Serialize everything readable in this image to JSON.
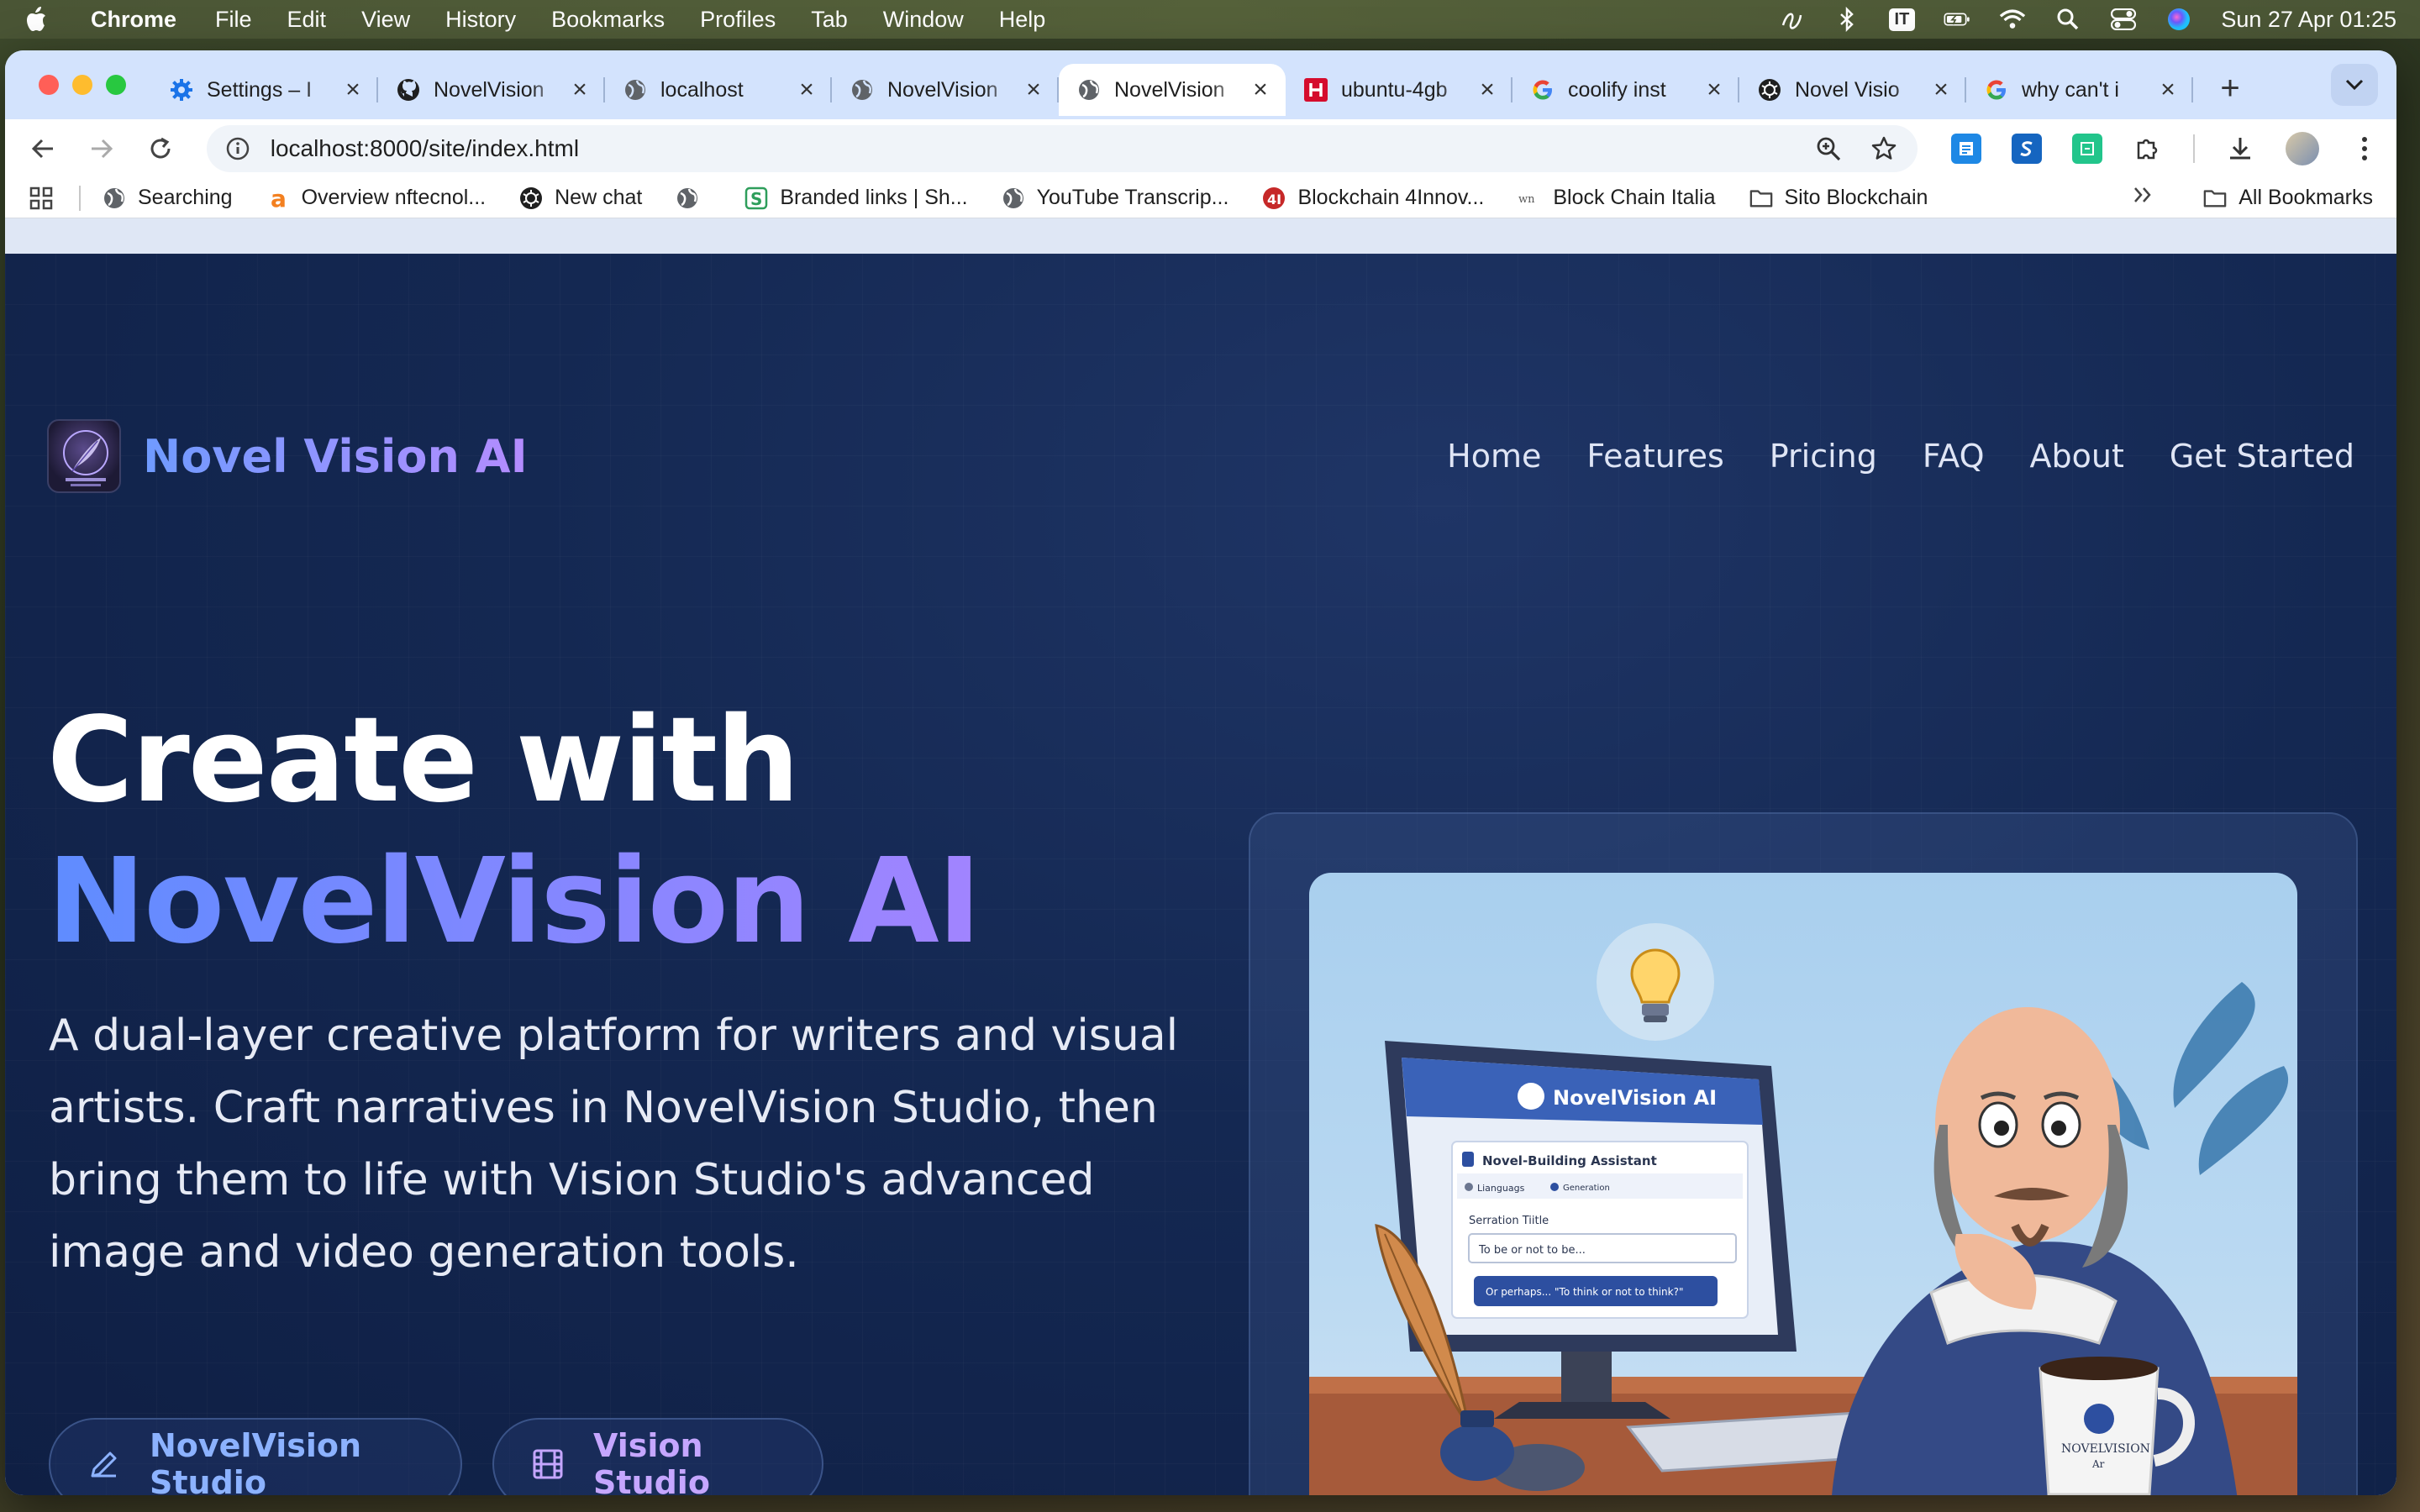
{
  "menubar": {
    "app_name": "Chrome",
    "menus": [
      "File",
      "Edit",
      "View",
      "History",
      "Bookmarks",
      "Profiles",
      "Tab",
      "Window",
      "Help"
    ],
    "input_source": "IT",
    "datetime": "Sun 27 Apr  01:25"
  },
  "tabs": [
    {
      "title": "Settings – I",
      "icon": "gear-icon",
      "active": false
    },
    {
      "title": "NovelVision",
      "icon": "github-icon",
      "active": false
    },
    {
      "title": "localhost",
      "icon": "globe-icon",
      "active": false
    },
    {
      "title": "NovelVision",
      "icon": "globe-icon",
      "active": false
    },
    {
      "title": "NovelVision",
      "icon": "globe-icon",
      "active": true
    },
    {
      "title": "ubuntu-4gb",
      "icon": "hetzner-icon",
      "active": false
    },
    {
      "title": "coolify inst",
      "icon": "google-icon",
      "active": false
    },
    {
      "title": "Novel Visio",
      "icon": "openai-icon",
      "active": false
    },
    {
      "title": "why can't i",
      "icon": "google-icon",
      "active": false
    }
  ],
  "toolbar": {
    "url": "localhost:8000/site/index.html"
  },
  "bookmarks": {
    "items": [
      {
        "label": "Searching",
        "icon": "globe-icon"
      },
      {
        "label": "Overview nftecnol...",
        "icon": "a-icon"
      },
      {
        "label": "New chat",
        "icon": "openai-icon"
      },
      {
        "label": "",
        "icon": "globe-icon"
      },
      {
        "label": "Branded links | Sh...",
        "icon": "s-icon"
      },
      {
        "label": "YouTube Transcrip...",
        "icon": "globe-icon"
      },
      {
        "label": "Blockchain 4Innov...",
        "icon": "b-icon"
      },
      {
        "label": "Block Chain Italia",
        "icon": "wn-icon"
      },
      {
        "label": "Sito Blockchain",
        "icon": "folder-icon"
      }
    ],
    "all_bookmarks": "All Bookmarks"
  },
  "site": {
    "brand": "Novel Vision AI",
    "nav": [
      "Home",
      "Features",
      "Pricing",
      "FAQ",
      "About",
      "Get Started"
    ],
    "hero_line1": "Create with",
    "hero_line2": "NovelVision AI",
    "hero_description": "A dual-layer creative platform for writers and visual artists. Craft narratives in NovelVision Studio, then bring them to life with Vision Studio's advanced image and video generation tools.",
    "cta_primary": "NovelVision Studio",
    "cta_secondary": "Vision Studio",
    "illustration": {
      "screen_title": "NovelVision AI",
      "panel_title": "Novel-Building Assistant",
      "tab_language": "Lianguags",
      "tab_generation": "Generation",
      "field_label": "Serration Tiitle",
      "field_value": "To be or not to be...",
      "button_text": "Or perhaps... \"To think or not to think?\"",
      "mug_text_line1": "NOVELVISION",
      "mug_text_line2": "Ar"
    }
  },
  "colors": {
    "brand_gradient_start": "#6f9bff",
    "brand_gradient_end": "#b48cff",
    "page_bg": "#142852"
  }
}
